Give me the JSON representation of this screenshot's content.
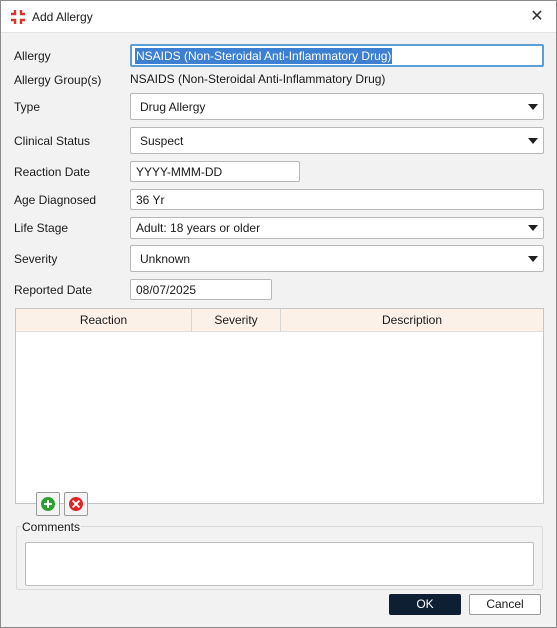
{
  "window": {
    "title": "Add Allergy",
    "close_glyph": "✕",
    "app_icon": "red-cross-icon"
  },
  "form": {
    "allergy_label": "Allergy",
    "allergy_value": "NSAIDS (Non-Steroidal Anti-Inflammatory Drug)",
    "group_label": "Allergy Group(s)",
    "group_value": "NSAIDS (Non-Steroidal Anti-Inflammatory Drug)",
    "type_label": "Type",
    "type_value": "Drug Allergy",
    "clinical_label": "Clinical Status",
    "clinical_value": "Suspect",
    "reaction_date_label": "Reaction Date",
    "reaction_date_placeholder": "YYYY-MMM-DD",
    "age_label": "Age Diagnosed",
    "age_value": "36 Yr",
    "life_stage_label": "Life Stage",
    "life_stage_value": "Adult: 18 years or older",
    "severity_label": "Severity",
    "severity_value": "Unknown",
    "reported_label": "Reported Date",
    "reported_value": "08/07/2025"
  },
  "reactions_table": {
    "columns": [
      "Reaction",
      "Severity",
      "Description"
    ],
    "rows": []
  },
  "table_actions": {
    "add_icon": "add-circle-icon",
    "remove_icon": "remove-circle-icon"
  },
  "comments": {
    "label": "Comments",
    "value": ""
  },
  "buttons": {
    "ok": "OK",
    "cancel": "Cancel"
  },
  "colors": {
    "ok_button": "#0f1f33",
    "selection": "#3d7fd0",
    "table_header": "#fbf1e8",
    "add_icon": "#2e9e2e",
    "remove_icon": "#e02424",
    "app_icon": "#d9342b"
  }
}
